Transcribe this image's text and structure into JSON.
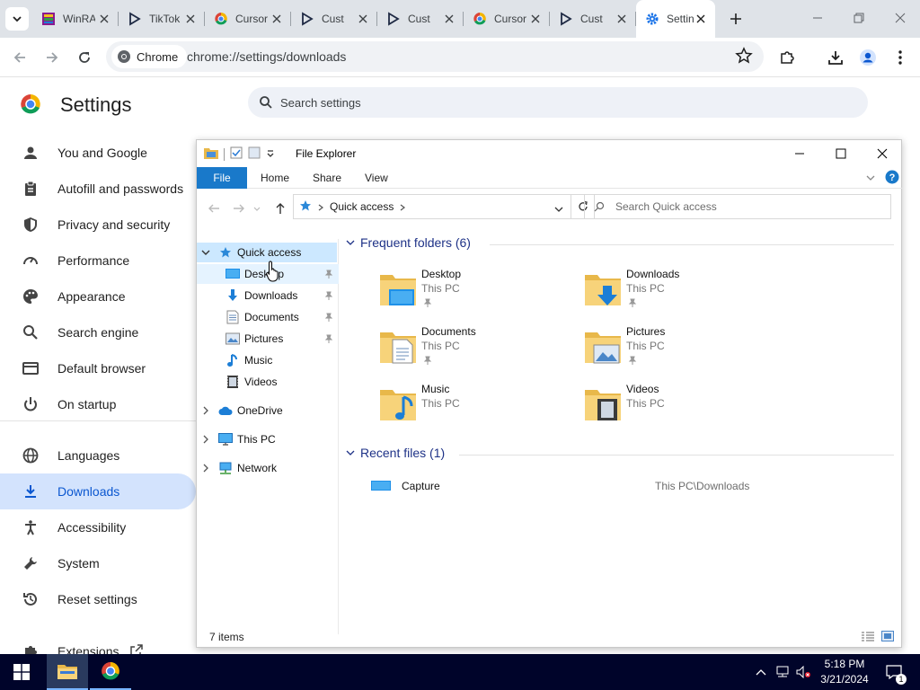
{
  "browser": {
    "tabs": [
      {
        "title": "WinRAR",
        "icon": "winrar-icon"
      },
      {
        "title": "TikTok",
        "icon": "cursor-play-icon"
      },
      {
        "title": "Cursor",
        "icon": "chrome-icon"
      },
      {
        "title": "Cust",
        "icon": "cursor-play-icon"
      },
      {
        "title": "Cust",
        "icon": "cursor-play-icon"
      },
      {
        "title": "Cursor",
        "icon": "chrome-icon"
      },
      {
        "title": "Cust",
        "icon": "cursor-play-icon"
      },
      {
        "title": "Settings",
        "icon": "gear-icon",
        "active": true
      }
    ],
    "chip_label": "Chrome",
    "url": "chrome://settings/downloads"
  },
  "settings": {
    "title": "Settings",
    "search_placeholder": "Search settings",
    "nav": [
      {
        "label": "You and Google",
        "icon": "person-icon"
      },
      {
        "label": "Autofill and passwords",
        "icon": "clipboard-icon"
      },
      {
        "label": "Privacy and security",
        "icon": "shield-icon"
      },
      {
        "label": "Performance",
        "icon": "speedometer-icon"
      },
      {
        "label": "Appearance",
        "icon": "palette-icon"
      },
      {
        "label": "Search engine",
        "icon": "search-icon"
      },
      {
        "label": "Default browser",
        "icon": "browser-icon"
      },
      {
        "label": "On startup",
        "icon": "power-icon"
      },
      {
        "label": "Languages",
        "icon": "globe-icon"
      },
      {
        "label": "Downloads",
        "icon": "download-icon",
        "selected": true
      },
      {
        "label": "Accessibility",
        "icon": "accessibility-icon"
      },
      {
        "label": "System",
        "icon": "wrench-icon"
      },
      {
        "label": "Reset settings",
        "icon": "history-icon"
      },
      {
        "label": "Extensions",
        "icon": "puzzle-icon"
      }
    ]
  },
  "explorer": {
    "title": "File Explorer",
    "ribbon": {
      "file": "File",
      "home": "Home",
      "share": "Share",
      "view": "View"
    },
    "address": "Quick access",
    "search_placeholder": "Search Quick access",
    "nav": {
      "quick_access": "Quick access",
      "items": [
        "Desktop",
        "Downloads",
        "Documents",
        "Pictures",
        "Music",
        "Videos"
      ],
      "onedrive": "OneDrive",
      "this_pc": "This PC",
      "network": "Network"
    },
    "frequent_header": "Frequent folders (6)",
    "folders": [
      {
        "name": "Desktop",
        "location": "This PC",
        "pinned": true
      },
      {
        "name": "Downloads",
        "location": "This PC",
        "pinned": true
      },
      {
        "name": "Documents",
        "location": "This PC",
        "pinned": true
      },
      {
        "name": "Pictures",
        "location": "This PC",
        "pinned": true
      },
      {
        "name": "Music",
        "location": "This PC",
        "pinned": false
      },
      {
        "name": "Videos",
        "location": "This PC",
        "pinned": false
      }
    ],
    "recent_header": "Recent files (1)",
    "recent": [
      {
        "name": "Capture",
        "path": "This PC\\Downloads"
      }
    ],
    "status": "7 items"
  },
  "taskbar": {
    "time": "5:18 PM",
    "date": "3/21/2024",
    "notification_count": "1"
  },
  "colors": {
    "accent_blue": "#1979ca",
    "folder_yellow": "#f2c94c",
    "taskbar": "#00042a"
  }
}
